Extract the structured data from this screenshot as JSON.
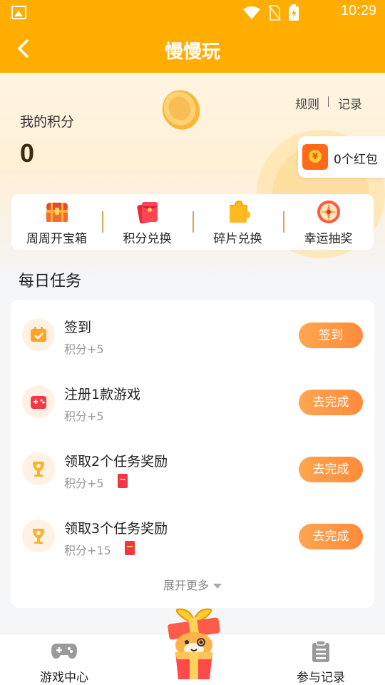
{
  "status_bar": {
    "time": "10:29",
    "icons": [
      "image-icon",
      "wifi-icon",
      "no-sim-icon",
      "battery-charging-icon"
    ]
  },
  "nav": {
    "title": "慢慢玩",
    "back_icon": "chevron-left-icon"
  },
  "score": {
    "label": "我的积分",
    "value": "0"
  },
  "links": {
    "rules": "规则",
    "records": "记录"
  },
  "red_packet": {
    "label": "0个红包",
    "icon": "red-packet-icon"
  },
  "quick_actions": [
    {
      "label": "周周开宝箱",
      "icon": "treasure-chest-icon"
    },
    {
      "label": "积分兑换",
      "icon": "red-envelope-icon"
    },
    {
      "label": "碎片兑换",
      "icon": "puzzle-icon"
    },
    {
      "label": "幸运抽奖",
      "icon": "lucky-wheel-icon"
    }
  ],
  "daily": {
    "title": "每日任务",
    "tasks": [
      {
        "name": "签到",
        "points": "积分+5",
        "button": "签到",
        "icon": "calendar-check-icon",
        "has_red_packet": false
      },
      {
        "name": "注册1款游戏",
        "points": "积分+5",
        "button": "去完成",
        "icon": "game-controller-icon",
        "has_red_packet": false
      },
      {
        "name": "领取2个任务奖励",
        "points": "积分+5",
        "button": "去完成",
        "icon": "trophy-icon",
        "has_red_packet": true
      },
      {
        "name": "领取3个任务奖励",
        "points": "积分+15",
        "button": "去完成",
        "icon": "trophy-icon",
        "has_red_packet": true
      }
    ],
    "expand_label": "展开更多"
  },
  "tabs": [
    {
      "label": "游戏中心",
      "icon": "gamepad-icon"
    },
    {
      "label": "参与记录",
      "icon": "clipboard-icon"
    }
  ],
  "colors": {
    "brand": "#ffae00",
    "button": "#ff8a3b",
    "red_packet": "#f23445"
  }
}
